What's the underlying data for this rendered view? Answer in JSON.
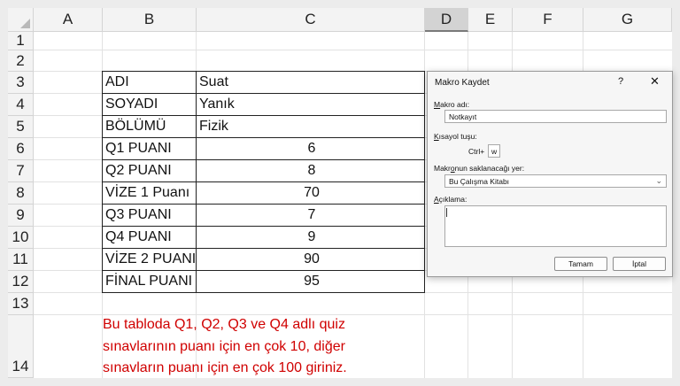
{
  "columns": [
    "A",
    "B",
    "C",
    "D",
    "E",
    "F",
    "G"
  ],
  "rows": [
    "1",
    "2",
    "3",
    "4",
    "5",
    "6",
    "7",
    "8",
    "9",
    "10",
    "11",
    "12",
    "13",
    "14"
  ],
  "table": [
    {
      "label": "ADI",
      "value": "Suat",
      "numeric": false
    },
    {
      "label": "SOYADI",
      "value": "Yanık",
      "numeric": false
    },
    {
      "label": "BÖLÜMÜ",
      "value": "Fizik",
      "numeric": false
    },
    {
      "label": "Q1 PUANI",
      "value": "6",
      "numeric": true
    },
    {
      "label": "Q2 PUANI",
      "value": "8",
      "numeric": true
    },
    {
      "label": "VİZE 1 Puanı",
      "value": "70",
      "numeric": true
    },
    {
      "label": "Q3 PUANI",
      "value": "7",
      "numeric": true
    },
    {
      "label": "Q4 PUANI",
      "value": "9",
      "numeric": true
    },
    {
      "label": "VİZE 2 PUANI",
      "value": "90",
      "numeric": true
    },
    {
      "label": "FİNAL PUANI",
      "value": "95",
      "numeric": true
    }
  ],
  "note": [
    "Bu tabloda Q1, Q2, Q3 ve Q4 adlı quiz",
    "sınavlarının puanı için en çok 10, diğer",
    "sınavların puanı için en çok 100 giriniz."
  ],
  "dialog": {
    "title": "Makro Kaydet",
    "help": "?",
    "close": "✕",
    "macro_name_label_u": "M",
    "macro_name_label_rest": "akro adı:",
    "macro_name_value": "Notkayıt",
    "shortcut_label_u": "K",
    "shortcut_label_rest": "ısayol tuşu:",
    "ctrl_prefix": "Ctrl+",
    "shortcut_key": "w",
    "store_label_pre": "Makr",
    "store_label_u": "o",
    "store_label_rest": "nun saklanacağı yer:",
    "store_value": "Bu Çalışma Kitabı",
    "desc_label_u": "A",
    "desc_label_rest": "çıklama:",
    "ok_label": "Tamam",
    "cancel_label": "İptal"
  },
  "colors": {
    "note_text": "#d00000",
    "selected_column_bg": "#d3d3d3"
  }
}
